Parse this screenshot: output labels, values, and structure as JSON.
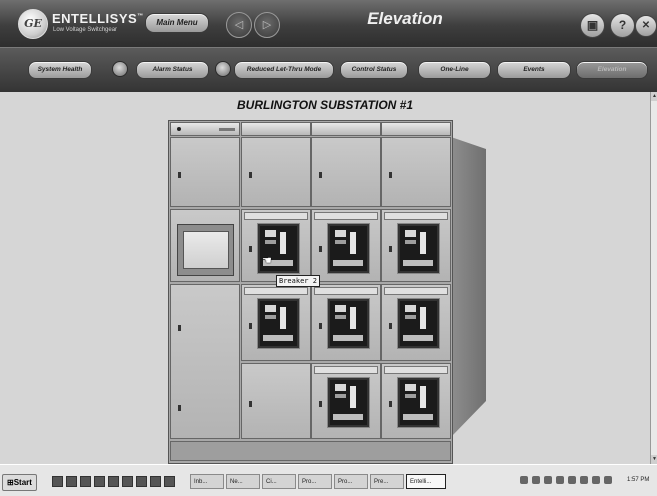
{
  "header": {
    "brand": "ENTELLISYS",
    "brand_tm": "™",
    "brand_sub": "Low Voltage Switchgear",
    "main_menu_label": "Main Menu",
    "title": "Elevation",
    "help_label": "?",
    "close_label": "✕",
    "back_label": "◁",
    "forward_label": "▷",
    "print_label": "▣"
  },
  "toolbar": {
    "buttons": [
      {
        "label": "System Health"
      },
      {
        "label": "Alarm Status"
      },
      {
        "label": "Reduced Let-Thru Mode"
      },
      {
        "label": "Control Status"
      },
      {
        "label": "One-Line"
      },
      {
        "label": "Events"
      },
      {
        "label": "Elevation",
        "disabled": true
      }
    ]
  },
  "main": {
    "title": "BURLINGTON SUBSTATION #1",
    "tooltip": "Breaker 2"
  },
  "taskbar": {
    "start_label": "Start",
    "tasks": [
      "Inb...",
      "Ne...",
      "Ci...",
      "Pro...",
      "Pro...",
      "Pre...",
      "Entelli..."
    ],
    "clock": "1:57 PM"
  },
  "colors": {
    "header_bg": "#3e3e3e",
    "main_bg": "#d6d6d6",
    "gear_gray": "#b3b3b3",
    "breaker_face": "#1b1b1b"
  }
}
